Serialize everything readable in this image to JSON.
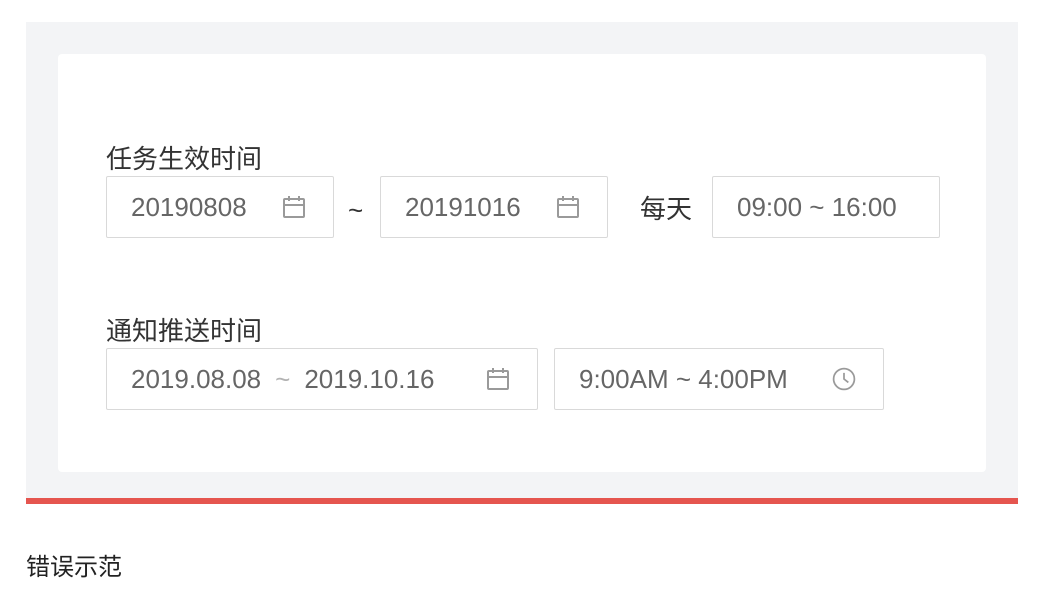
{
  "demo": {
    "task_section": {
      "label": "任务生效时间",
      "start_date": "20190808",
      "date_separator": "~",
      "end_date": "20191016",
      "recurrence_label": "每天",
      "time_range": "09:00 ~ 16:00"
    },
    "push_section": {
      "label": "通知推送时间",
      "start_date": "2019.08.08",
      "range_separator": "~",
      "end_date": "2019.10.16",
      "time_range": "9:00AM ~ 4:00PM"
    }
  },
  "verdict": {
    "status_color": "#e5554f",
    "label": "错误示范"
  },
  "icons": {
    "date": "calendar-icon",
    "time": "clock-icon"
  }
}
